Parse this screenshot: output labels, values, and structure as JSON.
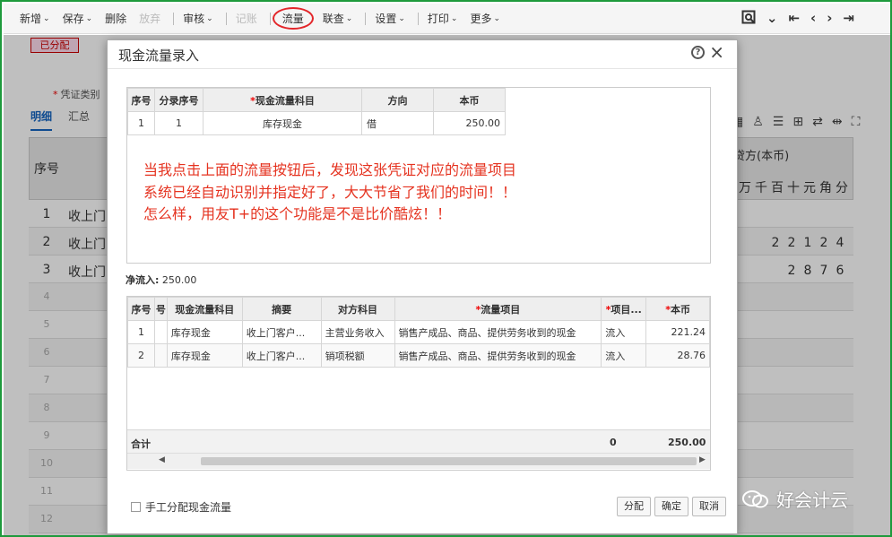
{
  "toolbar": {
    "items": [
      {
        "label": "新增",
        "caret": true,
        "disabled": false
      },
      {
        "label": "保存",
        "caret": true,
        "disabled": false
      },
      {
        "label": "删除",
        "caret": false,
        "disabled": false
      },
      {
        "label": "放弃",
        "caret": false,
        "disabled": true
      },
      {
        "label": "审核",
        "caret": true,
        "disabled": false
      },
      {
        "label": "记账",
        "caret": false,
        "disabled": true
      },
      {
        "label": "流量",
        "caret": false,
        "disabled": false,
        "highlight": true
      },
      {
        "label": "联查",
        "caret": true,
        "disabled": false
      },
      {
        "label": "设置",
        "caret": true,
        "disabled": false
      },
      {
        "label": "打印",
        "caret": true,
        "disabled": false
      },
      {
        "label": "更多",
        "caret": true,
        "disabled": false
      }
    ],
    "nav_icons": [
      "search-icon",
      "chevron-down-icon",
      "first-page-icon",
      "prev-page-icon",
      "next-page-icon",
      "last-page-icon"
    ]
  },
  "background": {
    "status_badge": "已分配",
    "voucher_type_label": "凭证类别",
    "tabs": [
      "明细",
      "汇总"
    ],
    "grid_header_seq": "序号",
    "credit_header": "贷方(本币)",
    "digit_headers": [
      "万",
      "千",
      "百",
      "十",
      "元",
      "角",
      "分"
    ],
    "rows": [
      {
        "no": "1",
        "text": "收上门",
        "digits": ""
      },
      {
        "no": "2",
        "text": "收上门",
        "digits": "22124"
      },
      {
        "no": "3",
        "text": "收上门",
        "digits": "2876"
      },
      {
        "no": "4",
        "text": "",
        "digits": ""
      },
      {
        "no": "5",
        "text": "",
        "digits": ""
      },
      {
        "no": "6",
        "text": "",
        "digits": ""
      },
      {
        "no": "7",
        "text": "",
        "digits": ""
      },
      {
        "no": "8",
        "text": "",
        "digits": ""
      },
      {
        "no": "9",
        "text": "",
        "digits": ""
      },
      {
        "no": "10",
        "text": "",
        "digits": ""
      },
      {
        "no": "11",
        "text": "",
        "digits": ""
      },
      {
        "no": "12",
        "text": "",
        "digits": ""
      }
    ]
  },
  "modal": {
    "title": "现金流量录入",
    "top_table": {
      "headers": [
        "序号",
        "分录序号",
        "现金流量科目",
        "方向",
        "本币"
      ],
      "row": [
        "1",
        "1",
        "库存现金",
        "借",
        "250.00"
      ]
    },
    "note_lines": [
      "当我点击上面的流量按钮后，发现这张凭证对应的流量项目",
      "系统已经自动识别并指定好了，大大节省了我们的时间！！",
      "怎么样，用友T+的这个功能是不是比价酷炫！！"
    ],
    "net_flow_label": "净流入:",
    "net_flow_value": "250.00",
    "bottom_table": {
      "headers": [
        "序号",
        "号",
        "现金流量科目",
        "摘要",
        "对方科目",
        "流量项目",
        "项目...",
        "本币"
      ],
      "rows": [
        [
          "1",
          "",
          "库存现金",
          "收上门客户...",
          "主营业务收入",
          "销售产成品、商品、提供劳务收到的现金",
          "流入",
          "221.24"
        ],
        [
          "2",
          "",
          "库存现金",
          "收上门客户...",
          "销项税额",
          "销售产成品、商品、提供劳务收到的现金",
          "流入",
          "28.76"
        ]
      ],
      "total_label": "合计",
      "total_count": "0",
      "total_amount": "250.00"
    },
    "manual_label": "手工分配现金流量",
    "buttons": {
      "allocate": "分配",
      "confirm": "确定",
      "cancel": "取消"
    }
  },
  "watermark": "好会计云"
}
